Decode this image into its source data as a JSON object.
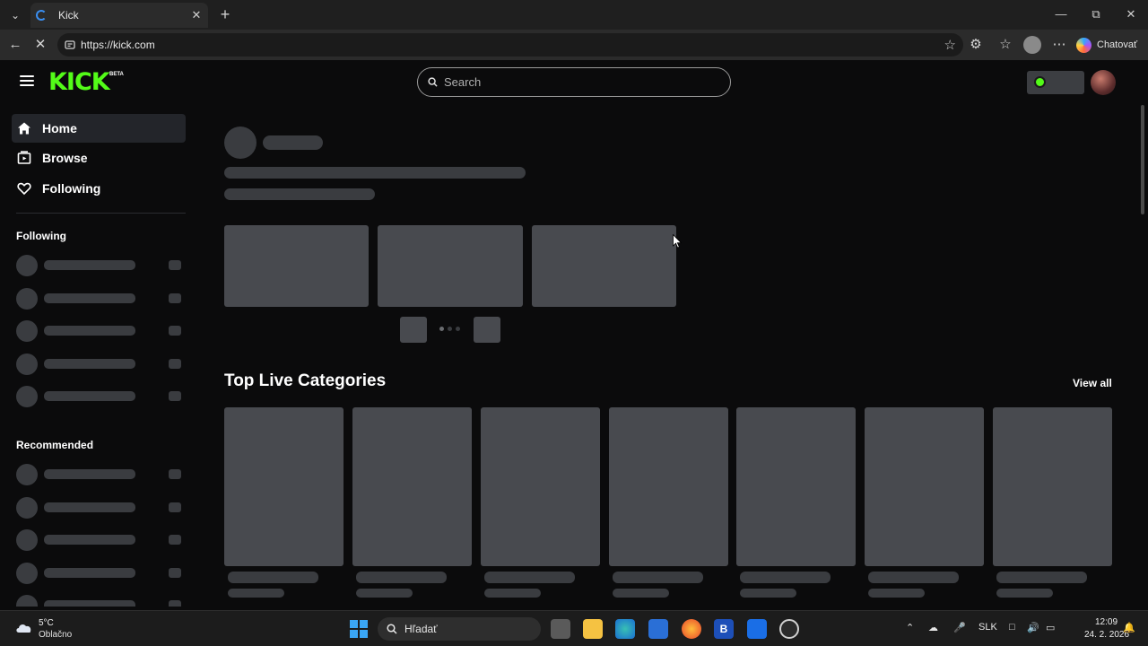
{
  "browser": {
    "tab_title": "Kick",
    "url": "https://kick.com",
    "copilot_label": "Chatovať"
  },
  "site": {
    "logo_text": "KICK",
    "logo_badge": "BETA",
    "brand_color": "#53fc18",
    "search_placeholder": "Search"
  },
  "sidebar": {
    "nav": [
      {
        "label": "Home",
        "icon": "home-icon",
        "active": true
      },
      {
        "label": "Browse",
        "icon": "browse-icon",
        "active": false
      },
      {
        "label": "Following",
        "icon": "heart-icon",
        "active": false
      }
    ],
    "following_heading": "Following",
    "recommended_heading": "Recommended"
  },
  "main": {
    "section_title": "Top Live Categories",
    "view_all_label": "View all"
  },
  "taskbar": {
    "weather_temp": "5°C",
    "weather_desc": "Oblačno",
    "search_label": "Hľadať",
    "language": "SLK",
    "time": "12:09",
    "date": "24. 2. 2026"
  }
}
